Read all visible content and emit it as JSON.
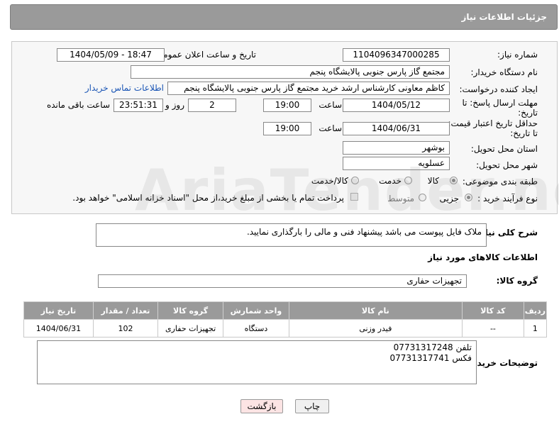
{
  "header": {
    "title": "جزئیات اطلاعات نیاز"
  },
  "form": {
    "need_number_label": "شماره نیاز:",
    "need_number": "1104096347000285",
    "announce_label": "تاریخ و ساعت اعلان عمومی:",
    "announce_value": "1404/05/09 - 18:47",
    "buyer_org_label": "نام دستگاه خریدار:",
    "buyer_org": "مجتمع گاز پارس جنوبی  پالایشگاه پنجم",
    "creator_label": "ایجاد کننده درخواست:",
    "creator": "کاظم معاونی کارشناس ارشد خرید مجتمع گاز پارس جنوبی  پالایشگاه پنجم",
    "contact_link": "اطلاعات تماس خریدار",
    "deadline_label_1": "مهلت ارسال پاسخ: تا",
    "deadline_label_2": "تاریخ:",
    "deadline_date": "1404/05/12",
    "time_label": "ساعت",
    "deadline_time": "19:00",
    "days_value": "2",
    "days_label": "روز و",
    "remaining_time": "23:51:31",
    "remaining_label": "ساعت باقی مانده",
    "validity_label_1": "حداقل تاریخ اعتبار قیمت:",
    "validity_label_2": "تا تاریخ:",
    "validity_date": "1404/06/31",
    "validity_time": "19:00",
    "province_label": "استان محل تحویل:",
    "province": "بوشهر",
    "city_label": "شهر محل تحویل:",
    "city": "عسلویه",
    "category_label": "طبقه بندی موضوعی:",
    "category_options": [
      "کالا",
      "خدمت",
      "کالا/خدمت"
    ],
    "process_label": "نوع فرآیند خرید :",
    "process_options": [
      "جزیی",
      "متوسط"
    ],
    "payment_note": "پرداخت تمام یا بخشی از مبلغ خرید،از محل \"اسناد خزانه اسلامی\" خواهد بود."
  },
  "description": {
    "label": "شرح کلی نیاز:",
    "text": "ملاک فایل پیوست می باشد پیشنهاد فنی و مالی را بارگذاری نمایید."
  },
  "goods": {
    "section_title": "اطلاعات کالاهای مورد نیاز",
    "group_label": "گروه کالا:",
    "group_value": "تجهیزات حفاری",
    "columns": [
      "ردیف",
      "کد کالا",
      "نام کالا",
      "واحد شمارش",
      "گروه کالا",
      "تعداد / مقدار",
      "تاریخ نیاز"
    ],
    "rows": [
      [
        "1",
        "--",
        "فیدر وزنی",
        "دستگاه",
        "تجهیزات حفاری",
        "102",
        "1404/06/31"
      ]
    ]
  },
  "buyer_notes": {
    "label": "توضیحات خریدار:",
    "line1": "تلفن 07731317248",
    "line2": "فکس 07731317741"
  },
  "buttons": {
    "print": "چاپ",
    "back": "بازگشت"
  },
  "watermark": "AriaTender.net"
}
